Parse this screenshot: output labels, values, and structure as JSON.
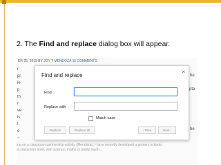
{
  "colors": {
    "accent": "#f0b429",
    "accent_dark": "#b8861a",
    "input_focus": "#4d90fe"
  },
  "caption": {
    "prefix": "2. The ",
    "bold": "Find and replace",
    "suffix": " dialog box will appear."
  },
  "doc": {
    "meta_date": "ER 25, 2015 BY ",
    "meta_author": "JOY T MENDOZA",
    "meta_comments": "15 COMMENTS",
    "right_fragments": [
      "he",
      "pta",
      "he"
    ],
    "left_fragments": [
      "r",
      "pl",
      "ie",
      "p",
      "th",
      "r",
      "ve",
      "is",
      "t",
      "e",
      "–"
    ],
    "bottom_lines": [
      "ing on a classroom partnership activity (Mendoza), I have recently developed a primary schools",
      "at classroom level, with science, maths or pretty much..."
    ]
  },
  "dialog": {
    "title": "Find and replace",
    "close_icon": "close-x-icon",
    "find_label": "Find",
    "find_value": "",
    "replace_label": "Replace with",
    "replace_value": "",
    "match_case_label": "Match case",
    "buttons": {
      "replace": "Replace",
      "replace_all": "Replace all",
      "prev": "‹ Prev",
      "next": "Next ›"
    }
  }
}
